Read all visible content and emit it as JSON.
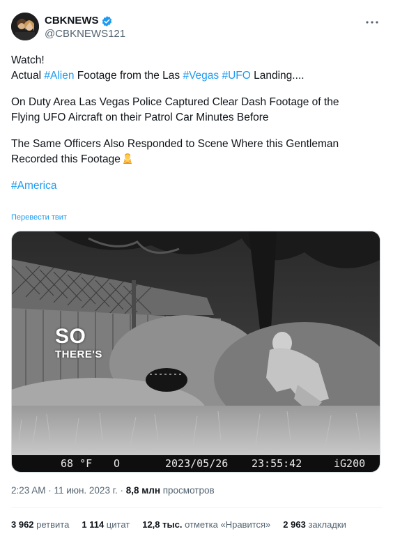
{
  "author": {
    "display_name": "CBKNEWS",
    "handle": "@CBKNEWS121",
    "verified_color": "#1d9bf0"
  },
  "tweet": {
    "lines": [
      [
        "Watch!"
      ],
      [
        "Actual ",
        "#Alien",
        " Footage from the Las ",
        "#Vegas",
        " ",
        "#UFO",
        " Landing...."
      ],
      [],
      [
        "On Duty Area Las Vegas Police Captured Clear Dash Footage of the"
      ],
      [
        "Flying UFO Aircraft on their Patrol Car Minutes Before"
      ],
      [],
      [
        "The Same Officers Also Responded to Scene Where this Gentleman"
      ],
      [
        "Recorded this Footage"
      ],
      [],
      [
        "#America"
      ]
    ],
    "translate_label": "Перевести твит",
    "emoji": "person-gesturing-no-emoji"
  },
  "media": {
    "overlay_line1": "SO",
    "overlay_line2": "THERE'S",
    "hud_temp": "68 °F",
    "hud_symbol": "O",
    "hud_date": "2023/05/26",
    "hud_time": "23:55:42",
    "hud_camera": "iG200"
  },
  "meta": {
    "time": "2:23 AM",
    "sep1": " · ",
    "date": "11 июн. 2023 г.",
    "sep2": " · ",
    "views_count": "8,8 млн",
    "views_label": " просмотров"
  },
  "stats": {
    "retweets_count": "3 962",
    "retweets_label": " ретвита",
    "quotes_count": "1 114",
    "quotes_label": " цитат",
    "likes_count": "12,8 тыс.",
    "likes_label": " отметка «Нравится»",
    "bookmarks_count": "2 963",
    "bookmarks_label": " закладки"
  },
  "colors": {
    "link": "#1d9bf0",
    "text": "#0f1419",
    "muted": "#536471"
  }
}
